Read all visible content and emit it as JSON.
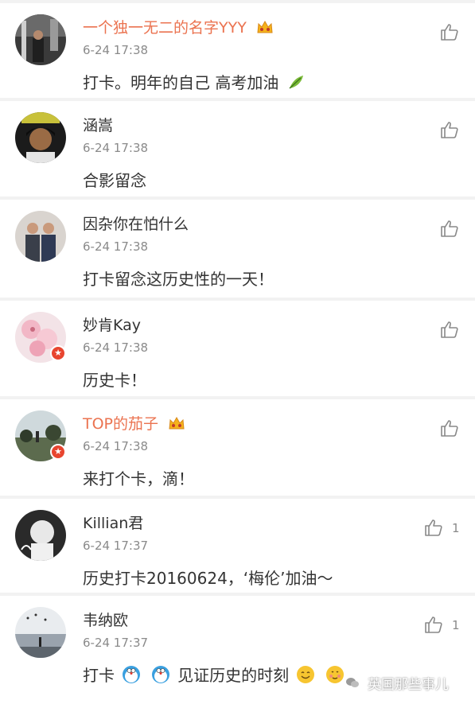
{
  "comments": [
    {
      "username": "一个独一无二的名字YYY",
      "vip": true,
      "time": "6-24 17:38",
      "text": "打卡。明年的自己  高考加油",
      "likes": ""
    },
    {
      "username": "涵嵩",
      "vip": false,
      "time": "6-24 17:38",
      "text": "合影留念",
      "likes": ""
    },
    {
      "username": "因杂你在怕什么",
      "vip": false,
      "time": "6-24 17:38",
      "text": "打卡留念这历史性的一天！",
      "likes": ""
    },
    {
      "username": "妙肯Kay",
      "vip": false,
      "time": "6-24 17:38",
      "text": "历史卡！",
      "likes": ""
    },
    {
      "username": "TOP的茄子",
      "vip": true,
      "time": "6-24 17:38",
      "text": "来打个卡，滴！",
      "likes": ""
    },
    {
      "username": "Killian君",
      "vip": false,
      "time": "6-24 17:37",
      "text": "历史打卡20160624，‘梅伦’加油～",
      "likes": "1"
    },
    {
      "username": "韦纳欧",
      "vip": false,
      "time": "6-24 17:37",
      "text_before": "打卡",
      "text_after": "见证历史的时刻",
      "likes": "1"
    }
  ],
  "watermark": {
    "text": "英国那些事儿"
  },
  "colors": {
    "vip_name": "#eb7350",
    "badge": "#e8452f"
  }
}
